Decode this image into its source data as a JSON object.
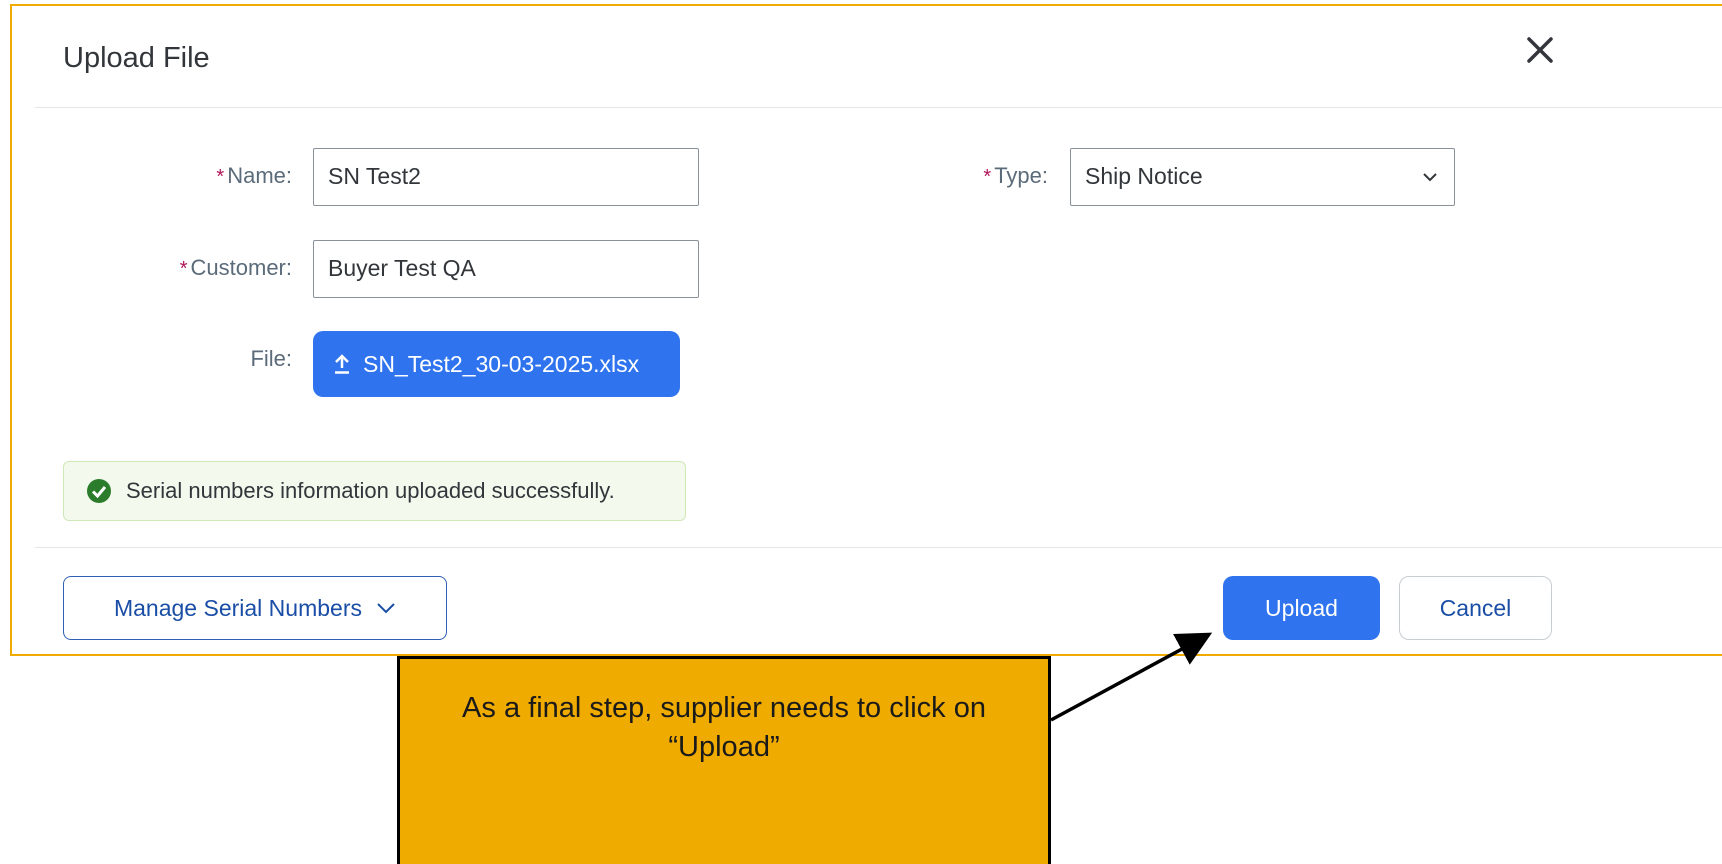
{
  "dialog": {
    "title": "Upload File",
    "close_icon": "close-icon"
  },
  "form": {
    "name": {
      "label": "Name:",
      "required": "*",
      "value": "SN Test2"
    },
    "type": {
      "label": "Type:",
      "required": "*",
      "value": "Ship Notice",
      "icon": "chevron-down-icon"
    },
    "customer": {
      "label": "Customer:",
      "required": "*",
      "value": "Buyer Test QA"
    },
    "file": {
      "label": "File:",
      "filename": "SN_Test2_30-03-2025.xlsx",
      "icon": "upload-icon"
    }
  },
  "message": {
    "text": "Serial numbers information uploaded successfully.",
    "icon": "success-check-icon",
    "status_color": "#2b7d2b"
  },
  "footer": {
    "manage_label": "Manage Serial Numbers",
    "upload_label": "Upload",
    "cancel_label": "Cancel"
  },
  "callout": {
    "line1": "As a final step, supplier needs to click on",
    "line2": "“Upload”"
  },
  "colors": {
    "accent": "#2f74ee",
    "callout_bg": "#f0ab00",
    "required": "#b0175b"
  }
}
